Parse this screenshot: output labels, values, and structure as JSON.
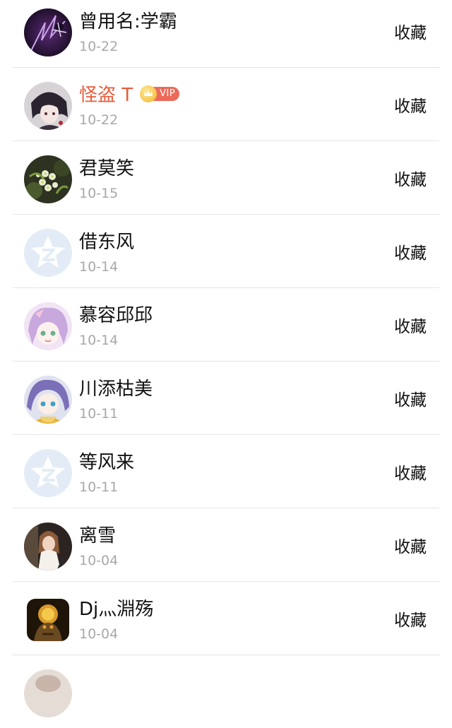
{
  "action_label": "收藏",
  "vip_badge_text": "VIP",
  "users": [
    {
      "name": "曾用名:学霸",
      "date": "10-22",
      "avatar": "dark-purple-art",
      "vip": false
    },
    {
      "name": "怪盗 T",
      "date": "10-22",
      "avatar": "anime-boy",
      "vip": true,
      "name_color": "#e85c3a"
    },
    {
      "name": "君莫笑",
      "date": "10-15",
      "avatar": "flowers",
      "vip": false
    },
    {
      "name": "借东风",
      "date": "10-14",
      "avatar": "default-qq-star",
      "vip": false
    },
    {
      "name": "慕容邱邱",
      "date": "10-14",
      "avatar": "anime-girl-pink",
      "vip": false
    },
    {
      "name": "川添枯美",
      "date": "10-11",
      "avatar": "anime-girl-blue",
      "vip": false
    },
    {
      "name": "等风来",
      "date": "10-11",
      "avatar": "default-qq-star",
      "vip": false
    },
    {
      "name": "离雪",
      "date": "10-04",
      "avatar": "girl-photo",
      "vip": false
    },
    {
      "name": "Dj灬淵殇",
      "date": "10-04",
      "avatar": "golden-warrior",
      "vip": false
    },
    {
      "name": "",
      "date": "",
      "avatar": "partial",
      "vip": false
    }
  ],
  "colors": {
    "vip_name": "#e85c3a",
    "date": "#a8a8a8",
    "divider": "#e4e4e4",
    "default_avatar_bg": "#e3ecf6"
  }
}
